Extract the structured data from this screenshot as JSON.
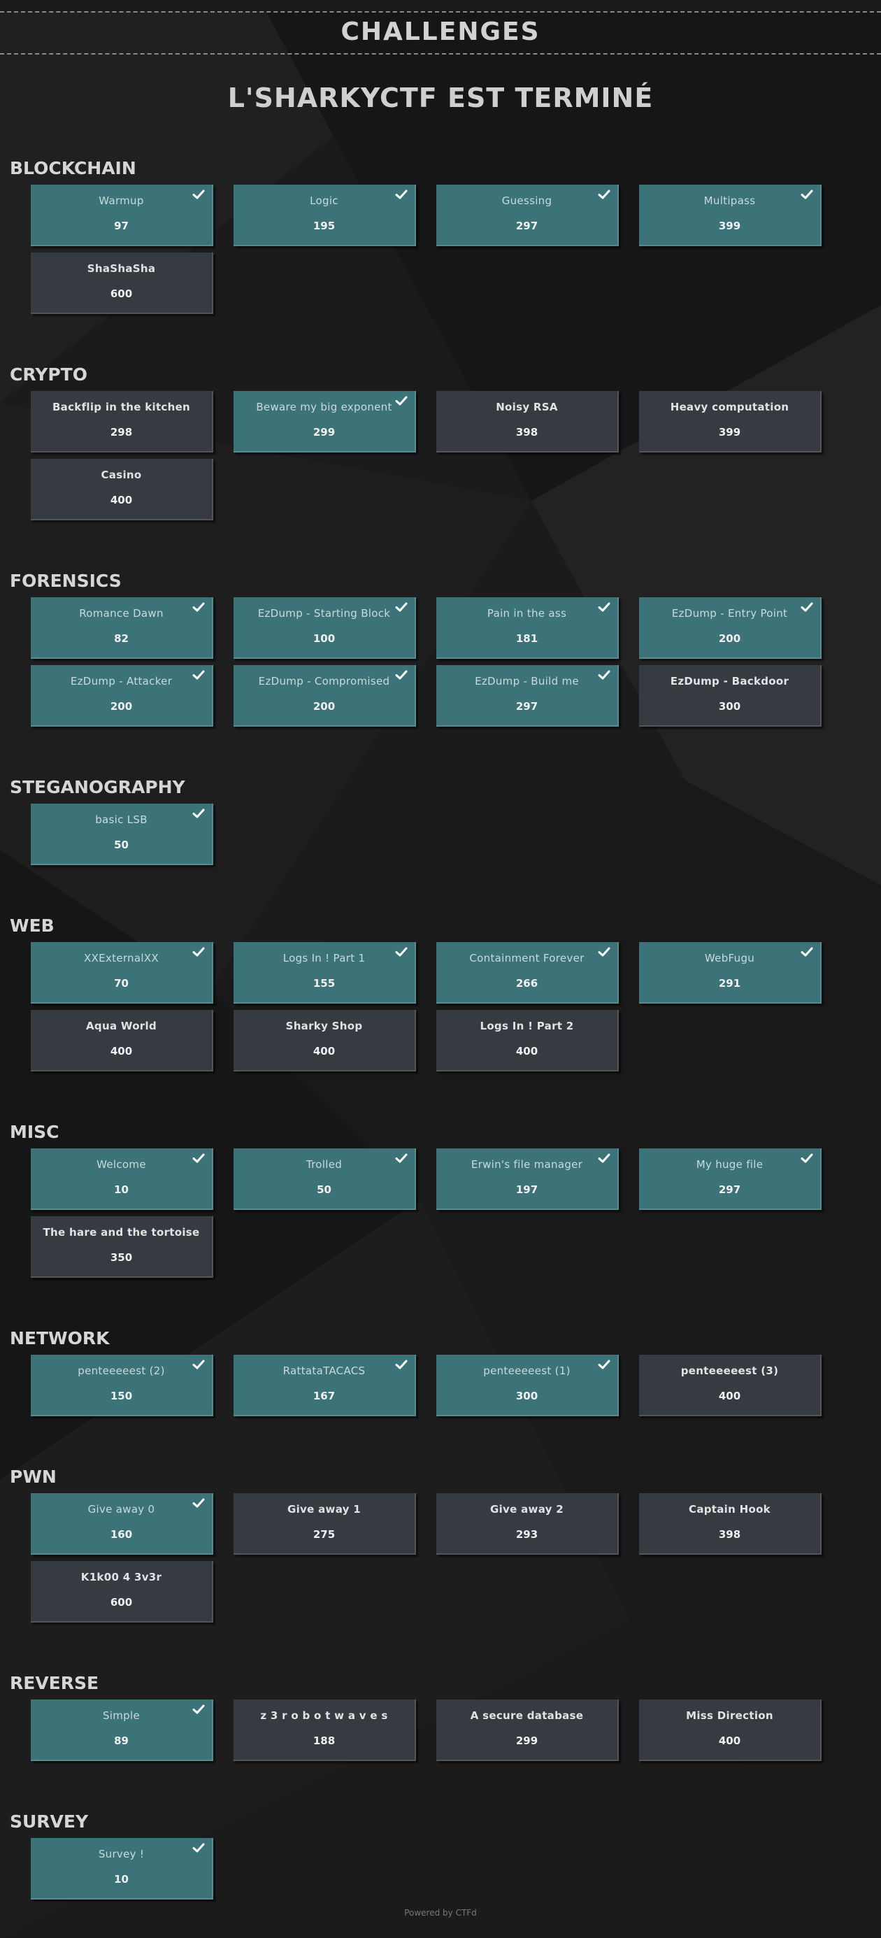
{
  "header": {
    "title": "CHALLENGES",
    "subtitle": "L'SHARKYCTF EST TERMINÉ"
  },
  "categories": [
    {
      "name": "BLOCKCHAIN",
      "challenges": [
        {
          "name": "Warmup",
          "points": "97",
          "solved": true
        },
        {
          "name": "Logic",
          "points": "195",
          "solved": true
        },
        {
          "name": "Guessing",
          "points": "297",
          "solved": true
        },
        {
          "name": "Multipass",
          "points": "399",
          "solved": true
        },
        {
          "name": "ShaShaSha",
          "points": "600",
          "solved": false
        }
      ]
    },
    {
      "name": "CRYPTO",
      "challenges": [
        {
          "name": "Backflip in the kitchen",
          "points": "298",
          "solved": false
        },
        {
          "name": "Beware my big exponent",
          "points": "299",
          "solved": true
        },
        {
          "name": "Noisy RSA",
          "points": "398",
          "solved": false
        },
        {
          "name": "Heavy computation",
          "points": "399",
          "solved": false
        },
        {
          "name": "Casino",
          "points": "400",
          "solved": false
        }
      ]
    },
    {
      "name": "FORENSICS",
      "challenges": [
        {
          "name": "Romance Dawn",
          "points": "82",
          "solved": true
        },
        {
          "name": "EzDump - Starting Block",
          "points": "100",
          "solved": true
        },
        {
          "name": "Pain in the ass",
          "points": "181",
          "solved": true
        },
        {
          "name": "EzDump - Entry Point",
          "points": "200",
          "solved": true
        },
        {
          "name": "EzDump - Attacker",
          "points": "200",
          "solved": true
        },
        {
          "name": "EzDump - Compromised",
          "points": "200",
          "solved": true
        },
        {
          "name": "EzDump - Build me",
          "points": "297",
          "solved": true
        },
        {
          "name": "EzDump - Backdoor",
          "points": "300",
          "solved": false
        }
      ]
    },
    {
      "name": "STEGANOGRAPHY",
      "challenges": [
        {
          "name": "basic LSB",
          "points": "50",
          "solved": true
        }
      ]
    },
    {
      "name": "WEB",
      "challenges": [
        {
          "name": "XXExternalXX",
          "points": "70",
          "solved": true
        },
        {
          "name": "Logs In ! Part 1",
          "points": "155",
          "solved": true
        },
        {
          "name": "Containment Forever",
          "points": "266",
          "solved": true
        },
        {
          "name": "WebFugu",
          "points": "291",
          "solved": true
        },
        {
          "name": "Aqua World",
          "points": "400",
          "solved": false
        },
        {
          "name": "Sharky Shop",
          "points": "400",
          "solved": false
        },
        {
          "name": "Logs In ! Part 2",
          "points": "400",
          "solved": false
        }
      ]
    },
    {
      "name": "MISC",
      "challenges": [
        {
          "name": "Welcome",
          "points": "10",
          "solved": true
        },
        {
          "name": "Trolled",
          "points": "50",
          "solved": true
        },
        {
          "name": "Erwin's file manager",
          "points": "197",
          "solved": true
        },
        {
          "name": "My huge file",
          "points": "297",
          "solved": true
        },
        {
          "name": "The hare and the tortoise",
          "points": "350",
          "solved": false
        }
      ]
    },
    {
      "name": "NETWORK",
      "challenges": [
        {
          "name": "penteeeeest (2)",
          "points": "150",
          "solved": true
        },
        {
          "name": "RattataTACACS",
          "points": "167",
          "solved": true
        },
        {
          "name": "penteeeeest (1)",
          "points": "300",
          "solved": true
        },
        {
          "name": "penteeeeest (3)",
          "points": "400",
          "solved": false
        }
      ]
    },
    {
      "name": "PWN",
      "challenges": [
        {
          "name": "Give away 0",
          "points": "160",
          "solved": true
        },
        {
          "name": "Give away 1",
          "points": "275",
          "solved": false
        },
        {
          "name": "Give away 2",
          "points": "293",
          "solved": false
        },
        {
          "name": "Captain Hook",
          "points": "398",
          "solved": false
        },
        {
          "name": "K1k00 4 3v3r",
          "points": "600",
          "solved": false
        }
      ]
    },
    {
      "name": "REVERSE",
      "challenges": [
        {
          "name": "Simple",
          "points": "89",
          "solved": true
        },
        {
          "name": "z 3 r o b o t w a v e s",
          "points": "188",
          "solved": false
        },
        {
          "name": "A secure database",
          "points": "299",
          "solved": false
        },
        {
          "name": "Miss Direction",
          "points": "400",
          "solved": false
        }
      ]
    },
    {
      "name": "SURVEY",
      "challenges": [
        {
          "name": "Survey !",
          "points": "10",
          "solved": true
        }
      ]
    }
  ],
  "footer": {
    "text": "Powered by CTFd"
  },
  "colors": {
    "solved": "#3c7379",
    "unsolved": "#363a41",
    "background": "#1a1a1a"
  },
  "icons": {
    "solved": "check-icon"
  }
}
